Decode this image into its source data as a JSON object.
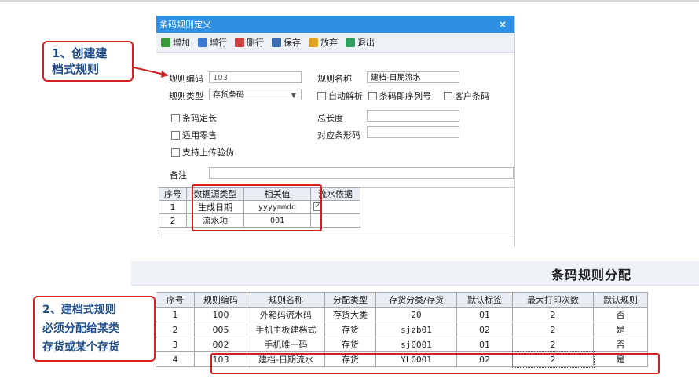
{
  "dialog": {
    "title": "条码规则定义",
    "close": "×",
    "toolbar": [
      {
        "label": "增加",
        "icon": "add-icon",
        "color": "#3a9a3a"
      },
      {
        "label": "增行",
        "icon": "add-row-icon",
        "color": "#3a7ad0"
      },
      {
        "label": "删行",
        "icon": "delete-row-icon",
        "color": "#d04040"
      },
      {
        "label": "保存",
        "icon": "save-icon",
        "color": "#3a6ab0"
      },
      {
        "label": "放弃",
        "icon": "discard-icon",
        "color": "#e0a020"
      },
      {
        "label": "退出",
        "icon": "exit-icon",
        "color": "#30a060"
      }
    ],
    "rule_code_label": "规则编码",
    "rule_code_value": "103",
    "rule_name_label": "规则名称",
    "rule_name_value": "建档-日期流水",
    "rule_type_label": "规则类型",
    "rule_type_value": "存货条码",
    "auto_parse": "自动解析",
    "barcode_serial": "条码即序列号",
    "customer_barcode": "客户条码",
    "fixed_length": "条码定长",
    "total_length_label": "总长度",
    "retail": "适用零售",
    "barcode_map_label": "对应条形码",
    "upload_verify": "支持上传验伪",
    "remark_label": "备注",
    "grid": {
      "headers": [
        "序号",
        "数据源类型",
        "相关值",
        "流水依据"
      ],
      "rows": [
        [
          "1",
          "生成日期",
          "yyyymmdd",
          true
        ],
        [
          "2",
          "流水项",
          "001",
          false
        ]
      ]
    }
  },
  "callout1": [
    "1、创建建",
    "档式规则"
  ],
  "callout2": [
    "2、建档式规则",
    "必须分配给某类",
    "存货或某个存货"
  ],
  "panel": {
    "title": "条码规则分配",
    "headers": [
      "序号",
      "规则编码",
      "规则名称",
      "分配类型",
      "存货分类/存货",
      "默认标签",
      "最大打印次数",
      "默认规则"
    ],
    "rows": [
      [
        "1",
        "100",
        "外箱码流水码",
        "存货大类",
        "20",
        "01",
        "2",
        "否"
      ],
      [
        "2",
        "005",
        "手机主板建档式",
        "存货",
        "sjzb01",
        "02",
        "2",
        "是"
      ],
      [
        "3",
        "002",
        "手机唯一码",
        "存货",
        "sj0001",
        "01",
        "2",
        "否"
      ],
      [
        "4",
        "103",
        "建档-日期流水",
        "存货",
        "YL0001",
        "02",
        "2",
        "是"
      ]
    ]
  }
}
